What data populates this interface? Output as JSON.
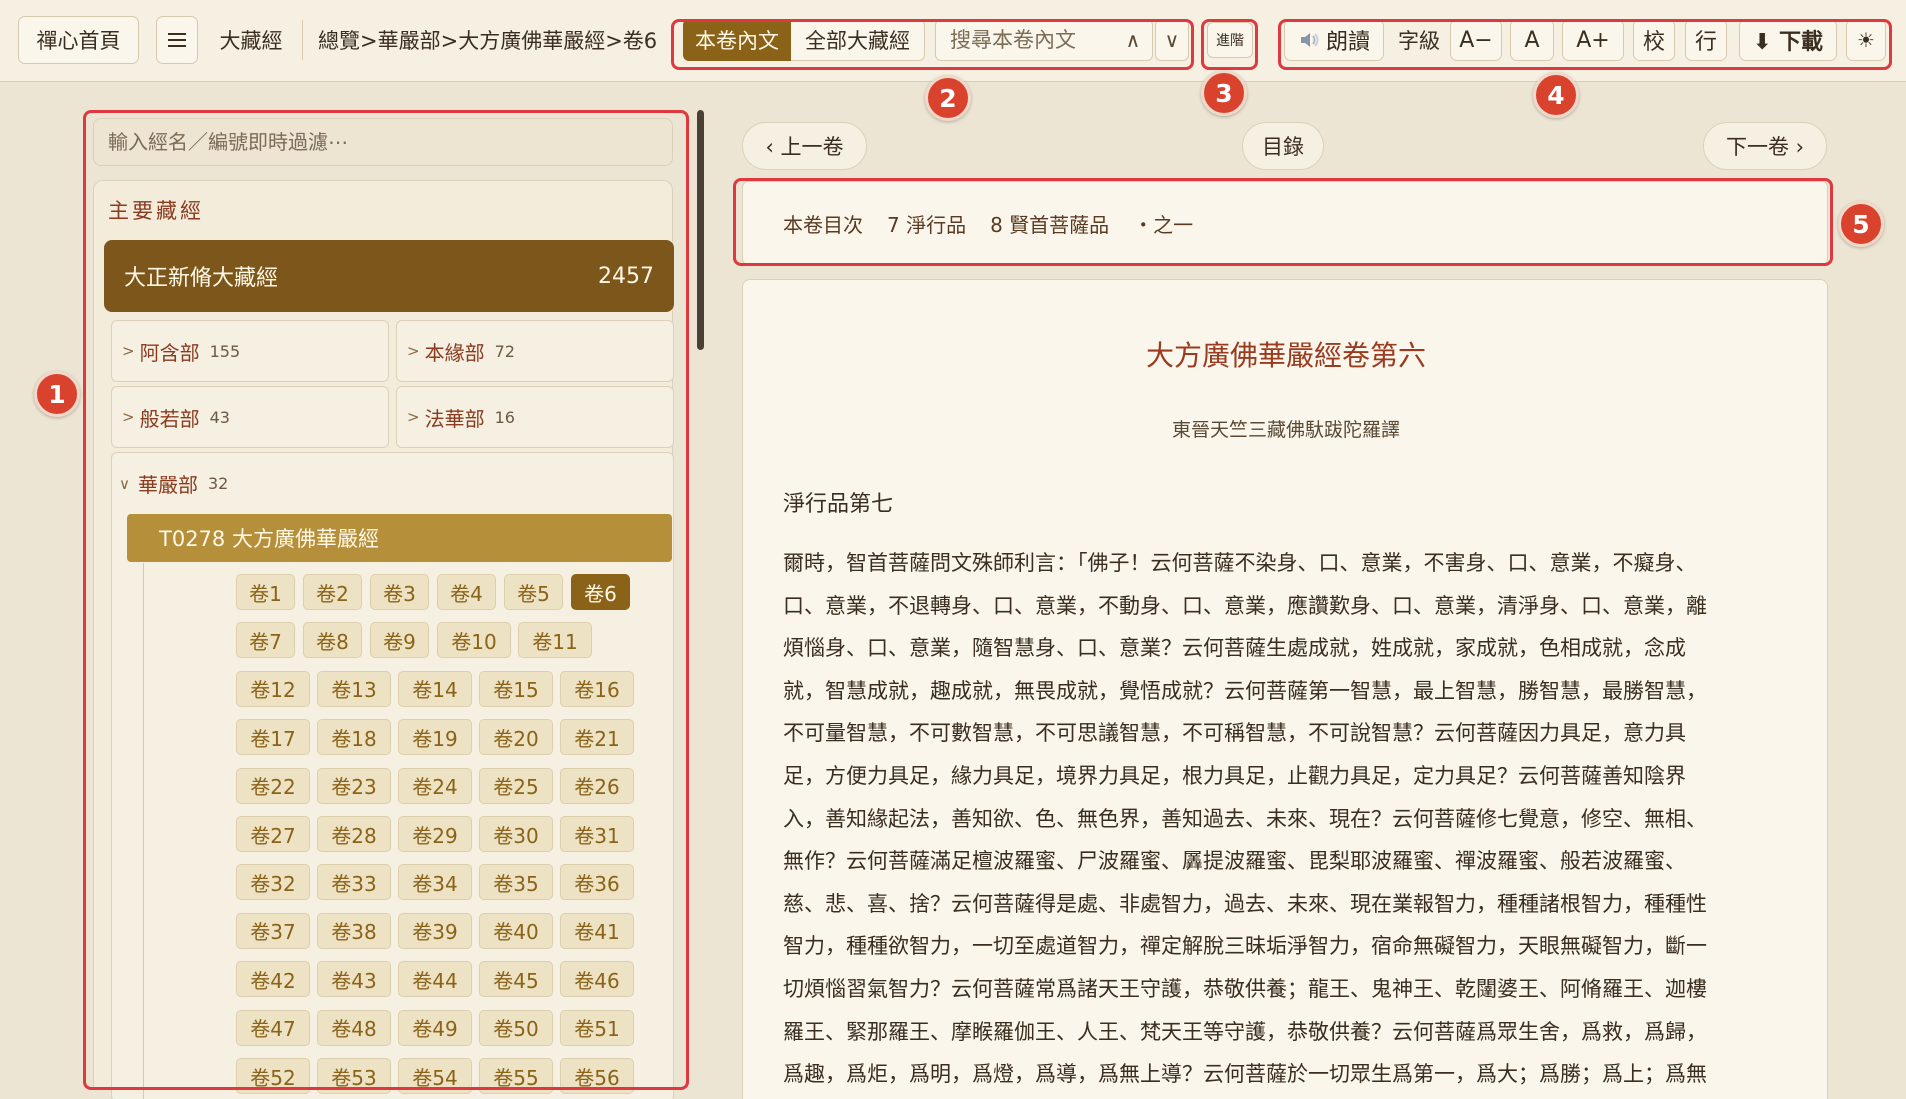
{
  "topbar": {
    "home": "禪心首頁",
    "menu_icon": "hamburger-icon",
    "canon": "大藏經",
    "breadcrumb": "總覽>華嚴部>大方廣佛華嚴經>卷6",
    "scope_current": "本卷內文",
    "scope_all": "全部大藏經",
    "search_placeholder": "搜尋本卷內文",
    "prev_match": "∧",
    "next_match": "∨",
    "advanced": "進階",
    "read_aloud": "朗讀",
    "font_size_label": "字級",
    "font_smaller": "A−",
    "font_reset": "A",
    "font_larger": "A+",
    "collate": "校",
    "line": "行",
    "download": "⬇ 下載",
    "theme_icon": "sun-icon",
    "theme": "☀"
  },
  "annotations": [
    "1",
    "2",
    "3",
    "4",
    "5"
  ],
  "sidebar": {
    "filter_placeholder": "輸入經名／編號即時過濾⋯",
    "section_title": "主要藏經",
    "canon": {
      "name": "大正新脩大藏經",
      "count": "2457"
    },
    "categories": [
      {
        "name": "阿含部",
        "count": "155"
      },
      {
        "name": "本緣部",
        "count": "72"
      },
      {
        "name": "般若部",
        "count": "43"
      },
      {
        "name": "法華部",
        "count": "16"
      }
    ],
    "expanded": {
      "name": "華嚴部",
      "count": "32"
    },
    "sutra": "T0278 大方廣佛華嚴經",
    "active_volume": "卷6",
    "volumes": [
      "卷1",
      "卷2",
      "卷3",
      "卷4",
      "卷5",
      "卷6",
      "卷7",
      "卷8",
      "卷9",
      "卷10",
      "卷11",
      "卷12",
      "卷13",
      "卷14",
      "卷15",
      "卷16",
      "卷17",
      "卷18",
      "卷19",
      "卷20",
      "卷21",
      "卷22",
      "卷23",
      "卷24",
      "卷25",
      "卷26",
      "卷27",
      "卷28",
      "卷29",
      "卷30",
      "卷31",
      "卷32",
      "卷33",
      "卷34",
      "卷35",
      "卷36",
      "卷37",
      "卷38",
      "卷39",
      "卷40",
      "卷41",
      "卷42",
      "卷43",
      "卷44",
      "卷45",
      "卷46",
      "卷47",
      "卷48",
      "卷49",
      "卷50",
      "卷51",
      "卷52",
      "卷53",
      "卷54",
      "卷55",
      "卷56"
    ]
  },
  "nav": {
    "prev": "‹ 上一卷",
    "toc": "目錄",
    "next": "下一卷 ›"
  },
  "toc_bar": {
    "label": "本卷目次",
    "items": [
      "7 淨行品",
      "8 賢首菩薩品",
      "・之一"
    ]
  },
  "reader": {
    "title": "大方廣佛華嚴經卷第六",
    "translator": "東晉天竺三藏佛馱跋陀羅譯",
    "chapter": "淨行品第七",
    "lines": [
      "爾時，智首菩薩問文殊師利言：「佛子！云何菩薩不染身、口、意業，不害身、口、意業，不癡身、",
      "口、意業，不退轉身、口、意業，不動身、口、意業，應讚歎身、口、意業，清淨身、口、意業，離",
      "煩惱身、口、意業，隨智慧身、口、意業？云何菩薩生處成就，姓成就，家成就，色相成就，念成",
      "就，智慧成就，趣成就，無畏成就，覺悟成就？云何菩薩第一智慧，最上智慧，勝智慧，最勝智慧，",
      "不可量智慧，不可數智慧，不可思議智慧，不可稱智慧，不可說智慧？云何菩薩因力具足，意力具",
      "足，方便力具足，緣力具足，境界力具足，根力具足，止觀力具足，定力具足？云何菩薩善知陰界",
      "入，善知緣起法，善知欲、色、無色界，善知過去、未來、現在？云何菩薩修七覺意，修空、無相、",
      "無作？云何菩薩滿足檀波羅蜜、尸波羅蜜、羼提波羅蜜、毘梨耶波羅蜜、禪波羅蜜、般若波羅蜜、",
      "慈、悲、喜、捨？云何菩薩得是處、非處智力，過去、未來、現在業報智力，種種諸根智力，種種性",
      "智力，種種欲智力，一切至處道智力，禪定解脫三昧垢淨智力，宿命無礙智力，天眼無礙智力，斷一",
      "切煩惱習氣智力？云何菩薩常爲諸天王守護，恭敬供養；龍王、鬼神王、乾闥婆王、阿脩羅王、迦樓",
      "羅王、緊那羅王、摩睺羅伽王、人王、梵天王等守護，恭敬供養？云何菩薩爲眾生舍，爲救，爲歸，",
      "爲趣，爲炬，爲明，爲燈，爲導，爲無上導？云何菩薩於一切眾生爲第一，爲大；爲勝；爲上；爲無"
    ]
  }
}
